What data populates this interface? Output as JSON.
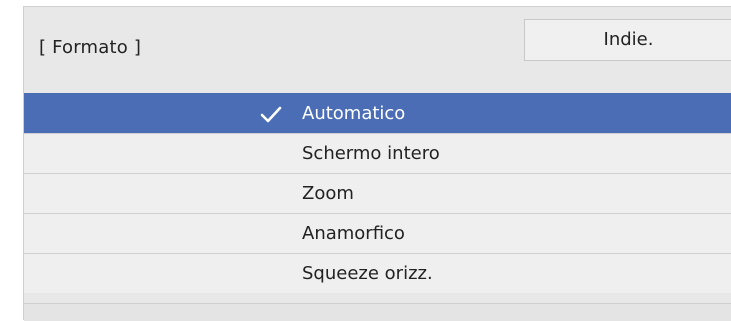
{
  "header": {
    "title": "[ Formato ]",
    "back_label": "Indie."
  },
  "menu": {
    "items": [
      {
        "label": "Automatico",
        "selected": true
      },
      {
        "label": "Schermo intero",
        "selected": false
      },
      {
        "label": "Zoom",
        "selected": false
      },
      {
        "label": "Anamorfico",
        "selected": false
      },
      {
        "label": "Squeeze orizz.",
        "selected": false
      }
    ]
  },
  "colors": {
    "selected_bg": "#4a6db5",
    "panel_bg": "#e8e8e8",
    "item_bg": "#efefef"
  },
  "icons": {
    "check": "check-icon"
  }
}
